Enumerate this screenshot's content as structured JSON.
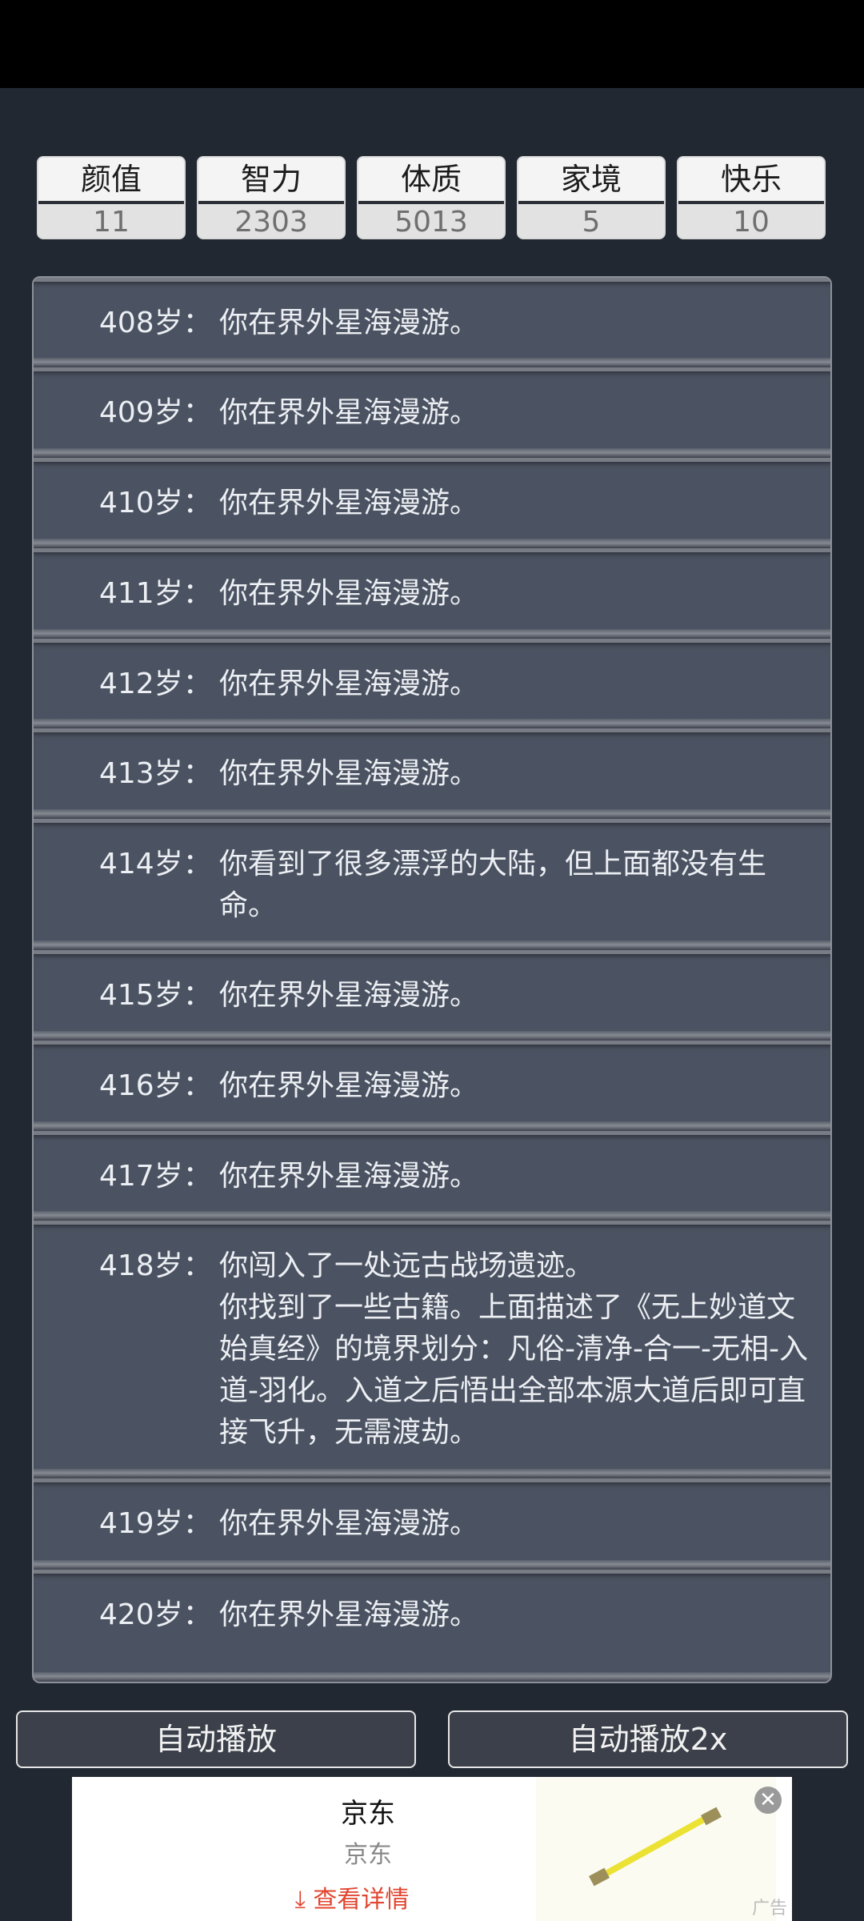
{
  "stats": [
    {
      "label": "颜值",
      "value": "11"
    },
    {
      "label": "智力",
      "value": "2303"
    },
    {
      "label": "体质",
      "value": "5013"
    },
    {
      "label": "家境",
      "value": "5"
    },
    {
      "label": "快乐",
      "value": "10"
    }
  ],
  "log": [
    {
      "age": "408岁：",
      "text": "你在界外星海漫游。"
    },
    {
      "age": "409岁：",
      "text": "你在界外星海漫游。"
    },
    {
      "age": "410岁：",
      "text": "你在界外星海漫游。"
    },
    {
      "age": "411岁：",
      "text": "你在界外星海漫游。"
    },
    {
      "age": "412岁：",
      "text": "你在界外星海漫游。"
    },
    {
      "age": "413岁：",
      "text": "你在界外星海漫游。"
    },
    {
      "age": "414岁：",
      "text": "你看到了很多漂浮的大陆，但上面都没有生命。"
    },
    {
      "age": "415岁：",
      "text": "你在界外星海漫游。"
    },
    {
      "age": "416岁：",
      "text": "你在界外星海漫游。"
    },
    {
      "age": "417岁：",
      "text": "你在界外星海漫游。"
    },
    {
      "age": "418岁：",
      "text": "你闯入了一处远古战场遗迹。",
      "text2": "你找到了一些古籍。上面描述了《无上妙道文始真经》的境界划分：凡俗-清净-合一-无相-入道-羽化。入道之后悟出全部本源大道后即可直接飞升，无需渡劫。"
    },
    {
      "age": "419岁：",
      "text": "你在界外星海漫游。"
    },
    {
      "age": "420岁：",
      "text": "你在界外星海漫游。"
    }
  ],
  "controls": {
    "auto_play": "自动播放",
    "auto_play_2x": "自动播放2x"
  },
  "ad": {
    "title": "京东",
    "subtitle": "京东",
    "link": "查看详情",
    "link_icon": "download-arrow-icon",
    "close_icon": "close-icon",
    "label": "广告"
  }
}
